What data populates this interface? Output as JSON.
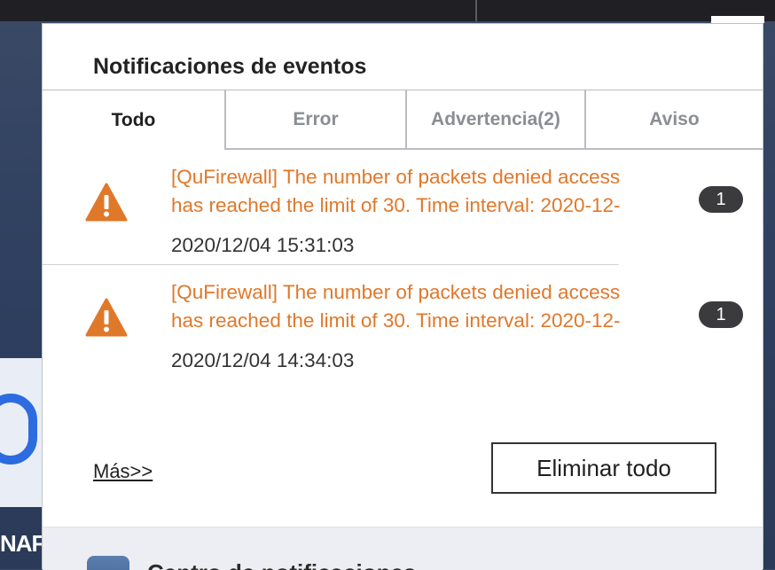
{
  "background": {
    "app_label": "NAF"
  },
  "panel": {
    "title": "Notificaciones de eventos",
    "tabs": [
      {
        "label": "Todo",
        "active": true
      },
      {
        "label": "Error",
        "active": false
      },
      {
        "label": "Advertencia(2)",
        "active": false
      },
      {
        "label": "Aviso",
        "active": false
      }
    ],
    "events": [
      {
        "icon": "warning-icon",
        "message_line1": "[QuFirewall] The number of packets denied access",
        "message_line2": "has reached the limit of 30. Time interval: 2020-12-",
        "timestamp": "2020/12/04 15:31:03",
        "count": "1"
      },
      {
        "icon": "warning-icon",
        "message_line1": "[QuFirewall] The number of packets denied access",
        "message_line2": "has reached the limit of 30. Time interval: 2020-12-",
        "timestamp": "2020/12/04 14:34:03",
        "count": "1"
      }
    ],
    "more_link": "Más>>",
    "clear_all_button": "Eliminar todo",
    "footer_text": "Centro de notificaciones"
  },
  "colors": {
    "warning": "#e0782a",
    "badge": "#3b3b3d"
  }
}
